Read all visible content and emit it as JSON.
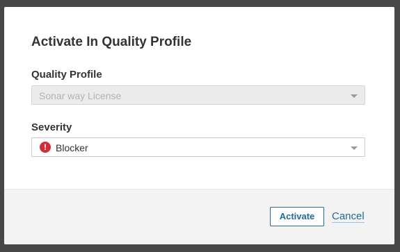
{
  "dialog": {
    "title": "Activate In Quality Profile",
    "quality_profile": {
      "label": "Quality Profile",
      "value": "Sonar way License"
    },
    "severity": {
      "label": "Severity",
      "value": "Blocker",
      "icon": "blocker-severity-icon",
      "icon_glyph": "!",
      "icon_color": "#d02f3a"
    },
    "actions": {
      "activate_label": "Activate",
      "cancel_label": "Cancel"
    }
  },
  "colors": {
    "accent": "#236a97",
    "overlay": "#474747"
  }
}
